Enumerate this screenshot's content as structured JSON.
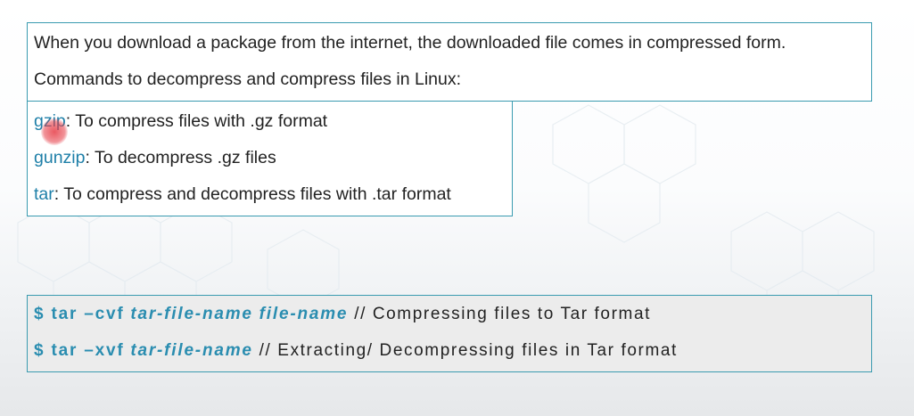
{
  "intro": {
    "line1": "When you download a package from the internet, the downloaded file comes in compressed form.",
    "line2": "Commands to decompress and compress files in Linux:"
  },
  "commands": [
    {
      "name": "gzip",
      "desc": ": To compress files with .gz format"
    },
    {
      "name": "gunzip",
      "desc": ": To decompress .gz files"
    },
    {
      "name": "tar",
      "desc": ": To compress and decompress files with .tar format"
    }
  ],
  "code": {
    "compress": {
      "cmd": "$ tar –cvf",
      "arg1": "tar-file-name",
      "arg2": "file-name",
      "comment": "// Compressing files to Tar format"
    },
    "extract": {
      "cmd": "$ tar –xvf",
      "arg1": "tar-file-name",
      "comment": "// Extracting/ Decompressing files in Tar format"
    }
  },
  "colors": {
    "accent": "#2a8db0",
    "border": "#3a9bb0",
    "cursor": "#e63c46"
  }
}
